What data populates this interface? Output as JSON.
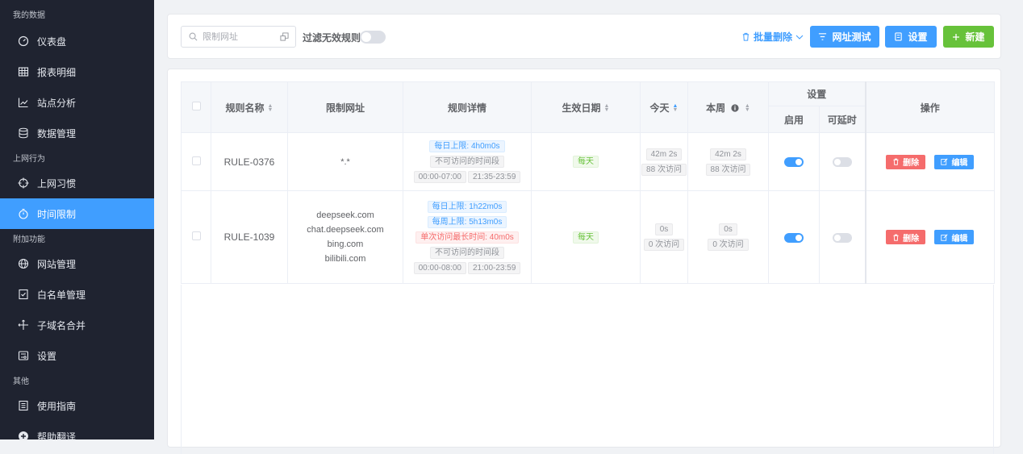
{
  "sidebar": {
    "sections": [
      {
        "title": "我的数据",
        "items": [
          {
            "label": "仪表盘",
            "icon": "dashboard-icon"
          },
          {
            "label": "报表明细",
            "icon": "table-icon"
          },
          {
            "label": "站点分析",
            "icon": "chart-icon"
          },
          {
            "label": "数据管理",
            "icon": "database-icon"
          }
        ]
      },
      {
        "title": "上网行为",
        "items": [
          {
            "label": "上网习惯",
            "icon": "crosshair-icon"
          },
          {
            "label": "时间限制",
            "icon": "timer-icon",
            "active": true
          }
        ]
      },
      {
        "title": "附加功能",
        "items": [
          {
            "label": "网站管理",
            "icon": "globe-icon"
          },
          {
            "label": "白名单管理",
            "icon": "checklist-icon"
          },
          {
            "label": "子域名合并",
            "icon": "merge-icon"
          },
          {
            "label": "设置",
            "icon": "settings-icon"
          }
        ]
      },
      {
        "title": "其他",
        "items": [
          {
            "label": "使用指南",
            "icon": "book-icon"
          },
          {
            "label": "帮助翻译",
            "icon": "translate-icon"
          }
        ]
      }
    ]
  },
  "toolbar": {
    "search_placeholder": "限制网址",
    "filter_label": "过滤无效规则",
    "filter_on": false,
    "batch_delete_label": "批量删除",
    "test_label": "网址测试",
    "settings_label": "设置",
    "new_label": "新建"
  },
  "table": {
    "headers": {
      "name": "规则名称",
      "urls": "限制网址",
      "detail": "规则详情",
      "date": "生效日期",
      "today": "今天",
      "week": "本周",
      "settings": "设置",
      "enabled": "启用",
      "delayable": "可延时",
      "actions": "操作"
    },
    "delete_label": "删除",
    "edit_label": "编辑",
    "rows": [
      {
        "name": "RULE-0376",
        "urls": [
          "*.*"
        ],
        "tags": [
          [
            {
              "text": "每日上限: 4h0m0s",
              "style": "blue"
            }
          ],
          [
            {
              "text": "不可访问的时间段",
              "style": "gray"
            }
          ],
          [
            {
              "text": "00:00-07:00",
              "style": "gray"
            },
            {
              "text": "21:35-23:59",
              "style": "gray"
            }
          ]
        ],
        "date": "每天",
        "today_time": "42m 2s",
        "today_visits": "88 次访问",
        "week_time": "42m 2s",
        "week_visits": "88 次访问",
        "enabled": true,
        "delayable": false
      },
      {
        "name": "RULE-1039",
        "urls": [
          "deepseek.com",
          "chat.deepseek.com",
          "bing.com",
          "bilibili.com"
        ],
        "tags": [
          [
            {
              "text": "每日上限: 1h22m0s",
              "style": "blue"
            }
          ],
          [
            {
              "text": "每周上限: 5h13m0s",
              "style": "blue"
            }
          ],
          [
            {
              "text": "单次访问最长时间: 40m0s",
              "style": "red"
            }
          ],
          [
            {
              "text": "不可访问的时间段",
              "style": "gray"
            }
          ],
          [
            {
              "text": "00:00-08:00",
              "style": "gray"
            },
            {
              "text": "21:00-23:59",
              "style": "gray"
            }
          ]
        ],
        "date": "每天",
        "today_time": "0s",
        "today_visits": "0 次访问",
        "week_time": "0s",
        "week_visits": "0 次访问",
        "enabled": true,
        "delayable": false
      }
    ]
  },
  "colors": {
    "primary": "#409eff",
    "success": "#67c23a",
    "danger": "#f56c6c",
    "sidebar_bg": "#1f2330"
  }
}
